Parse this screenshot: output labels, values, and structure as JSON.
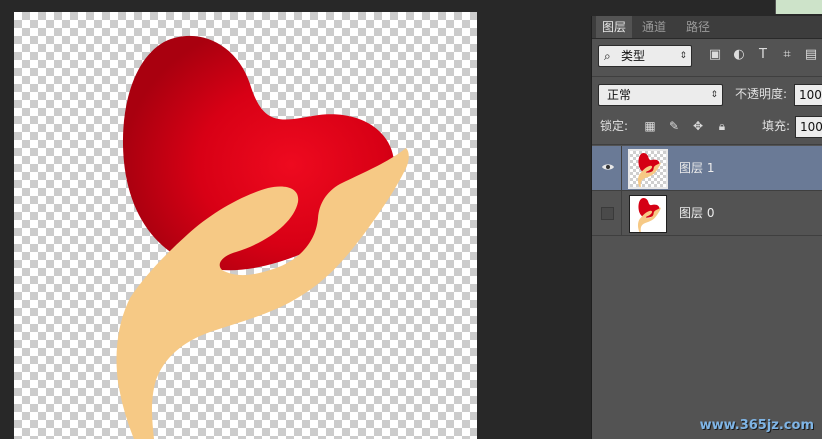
{
  "panel": {
    "tabs": [
      {
        "label": "图层",
        "active": true
      },
      {
        "label": "通道",
        "active": false
      },
      {
        "label": "路径",
        "active": false
      }
    ],
    "filter": {
      "label": "类型",
      "icons": [
        "image-filter-icon",
        "adjustment-filter-icon",
        "type-filter-icon",
        "shape-filter-icon",
        "smart-object-filter-icon"
      ]
    },
    "blend_mode": "正常",
    "opacity_label": "不透明度:",
    "opacity_value": "100",
    "lock_label": "锁定:",
    "fill_label": "填充:",
    "fill_value": "100",
    "layers": [
      {
        "name": "图层 1",
        "visible": true,
        "selected": true
      },
      {
        "name": "图层 0",
        "visible": false,
        "selected": false
      }
    ]
  },
  "watermark": "www.365jz.com",
  "colors": {
    "heart": "#e3001a",
    "heart_dark": "#a8000f",
    "hand": "#f6c985",
    "selected_layer": "#6a7a96",
    "panel_bg": "#535353",
    "workspace": "#282828"
  }
}
